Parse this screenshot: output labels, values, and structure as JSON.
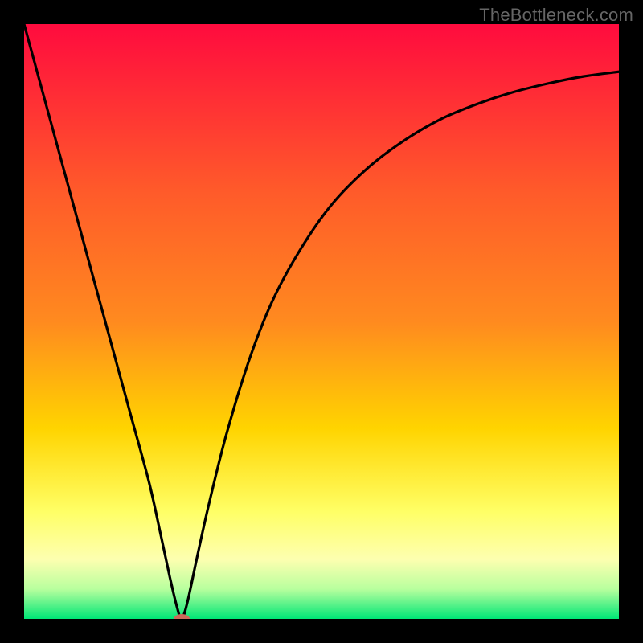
{
  "watermark": "TheBottleneck.com",
  "chart_data": {
    "type": "line",
    "title": "",
    "xlabel": "",
    "ylabel": "",
    "xlim": [
      0,
      100
    ],
    "ylim": [
      0,
      100
    ],
    "grid": false,
    "background_gradient": {
      "top": "#ff0b3e",
      "mid_upper": "#ff8a1f",
      "mid": "#ffd400",
      "mid_lower": "#ffff66",
      "bottom": "#00e676"
    },
    "series": [
      {
        "name": "bottleneck-curve",
        "color": "#000000",
        "x": [
          0,
          3,
          6,
          9,
          12,
          15,
          18,
          21,
          23,
          24.5,
          25.7,
          26.5,
          27.5,
          29,
          31,
          34,
          38,
          42,
          47,
          52,
          58,
          64,
          70,
          76,
          82,
          88,
          94,
          100
        ],
        "y": [
          100,
          89,
          78,
          67,
          56,
          45,
          34,
          23,
          14,
          7,
          2,
          0,
          3,
          10,
          19,
          31,
          44,
          54,
          63,
          70,
          76,
          80.5,
          84,
          86.5,
          88.5,
          90,
          91.2,
          92
        ]
      }
    ],
    "marker": {
      "name": "minimum-marker",
      "x": 26.5,
      "y": 0,
      "color": "#cc6b5a",
      "rx": 10,
      "ry": 6
    }
  }
}
